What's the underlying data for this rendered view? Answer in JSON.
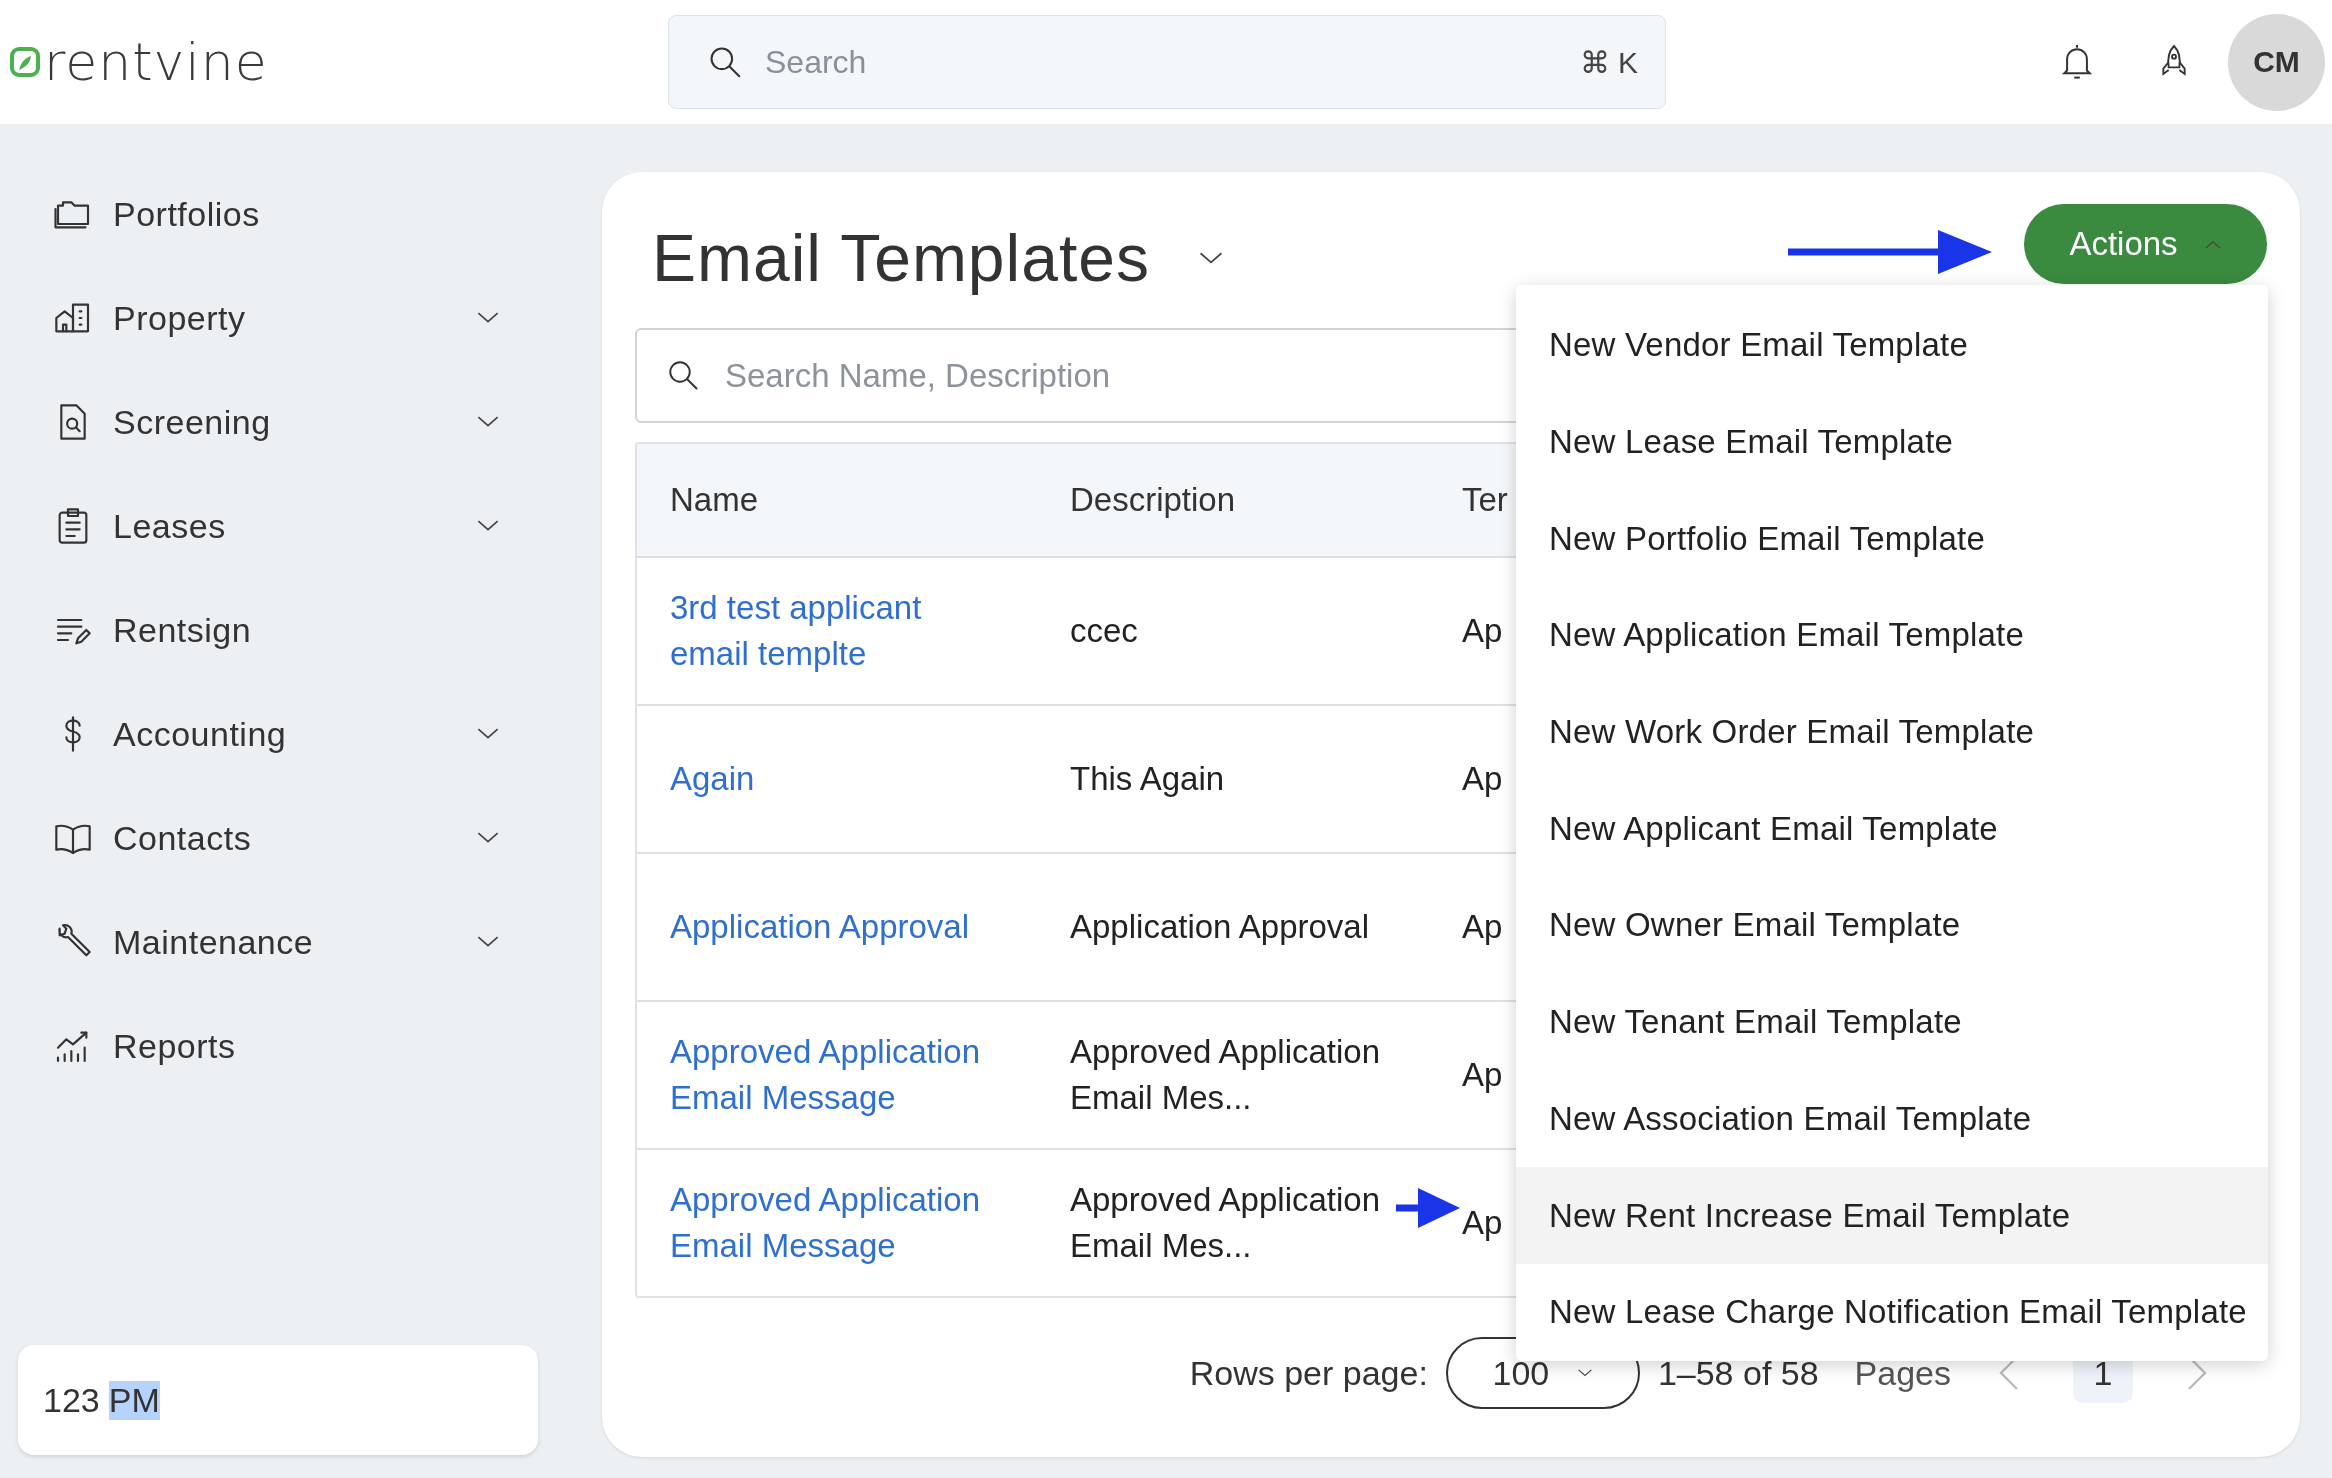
{
  "logo": {
    "text": "rentvine"
  },
  "search": {
    "placeholder": "Search",
    "shortcut": "⌘ K"
  },
  "user": {
    "initials": "CM"
  },
  "sidebar": {
    "items": [
      {
        "label": "Portfolios",
        "has_submenu": false
      },
      {
        "label": "Property",
        "has_submenu": true
      },
      {
        "label": "Screening",
        "has_submenu": true
      },
      {
        "label": "Leases",
        "has_submenu": true
      },
      {
        "label": "Rentsign",
        "has_submenu": false
      },
      {
        "label": "Accounting",
        "has_submenu": true
      },
      {
        "label": "Contacts",
        "has_submenu": true
      },
      {
        "label": "Maintenance",
        "has_submenu": true
      },
      {
        "label": "Reports",
        "has_submenu": false
      }
    ],
    "note": [
      {
        "text": "123",
        "highlighted": false
      },
      {
        "text": "PM",
        "highlighted": true
      }
    ]
  },
  "page": {
    "title": "Email Templates",
    "actions_button": "Actions",
    "actions_open": true,
    "filter": {
      "placeholder": "Search Name, Description"
    },
    "table": {
      "columns": [
        "Name",
        "Description",
        "Ter"
      ],
      "rows": [
        {
          "name": "3rd test applicant email templte",
          "description": "ccec",
          "column_3": "Ap"
        },
        {
          "name": "Again",
          "description": "This Again",
          "column_3": "Ap"
        },
        {
          "name": "Application Approval",
          "description": "Application Approval",
          "column_3": "Ap"
        },
        {
          "name": "Approved Application Email Message",
          "description": "Approved Application Email Mes...",
          "column_3": "Ap"
        },
        {
          "name": "Approved Application Email Message",
          "description": "Approved Application Email Mes...",
          "column_3": "Ap"
        }
      ]
    },
    "pagination": {
      "rows_label": "Rows per page:",
      "rows_value": "100",
      "range": "1–58 of 58",
      "pages_label": "Pages",
      "page": "1"
    },
    "actions_menu": [
      {
        "label": "New Vendor Email Template",
        "hovered": false
      },
      {
        "label": "New Lease Email Template",
        "hovered": false
      },
      {
        "label": "New Portfolio Email Template",
        "hovered": false
      },
      {
        "label": "New Application Email Template",
        "hovered": false
      },
      {
        "label": "New Work Order Email Template",
        "hovered": false
      },
      {
        "label": "New Applicant Email Template",
        "hovered": false
      },
      {
        "label": "New Owner Email Template",
        "hovered": false
      },
      {
        "label": "New Tenant Email Template",
        "hovered": false
      },
      {
        "label": "New Association Email Template",
        "hovered": false
      },
      {
        "label": "New Rent Increase Email Template",
        "hovered": true
      },
      {
        "label": "New Lease Charge Notification Email Template",
        "hovered": false
      }
    ]
  }
}
